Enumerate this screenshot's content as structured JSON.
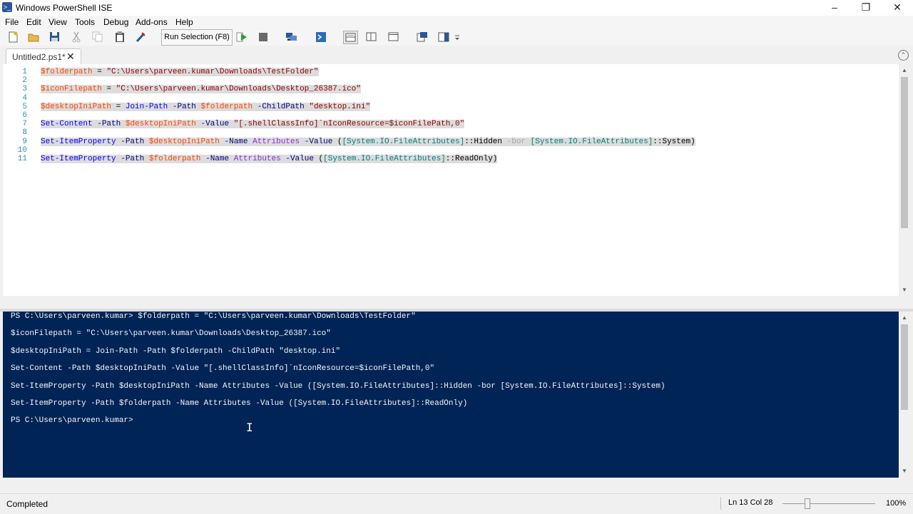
{
  "window": {
    "title": "Windows PowerShell ISE"
  },
  "menu": [
    "File",
    "Edit",
    "View",
    "Tools",
    "Debug",
    "Add-ons",
    "Help"
  ],
  "toolbar": {
    "run_selection_label": "Run Selection (F8)",
    "icons": [
      "new-file-icon",
      "open-folder-icon",
      "save-icon",
      "cut-icon",
      "copy-icon",
      "paste-icon",
      "clear-icon",
      "run-selection-button",
      "run-script-icon",
      "stop-icon",
      "remote-powershell-icon",
      "start-powershell-icon",
      "show-script-top-icon",
      "show-script-right-icon",
      "show-script-maximized-icon",
      "show-command-window-icon",
      "show-command-addon-icon",
      "customize-dropdown-icon"
    ]
  },
  "tabs": [
    {
      "label": "Untitled2.ps1*"
    }
  ],
  "editor": {
    "lines": [
      {
        "n": "1",
        "tokens": [
          [
            "var",
            "$folderpath"
          ],
          [
            "pl",
            " = "
          ],
          [
            "str",
            "\"C:\\Users\\parveen.kumar\\Downloads\\TestFolder\""
          ]
        ]
      },
      {
        "n": "2",
        "tokens": []
      },
      {
        "n": "3",
        "tokens": [
          [
            "var",
            "$iconFilepath"
          ],
          [
            "pl",
            " = "
          ],
          [
            "str",
            "\"C:\\Users\\parveen.kumar\\Downloads\\Desktop_26387.ico\""
          ]
        ]
      },
      {
        "n": "4",
        "tokens": []
      },
      {
        "n": "5",
        "tokens": [
          [
            "var",
            "$desktopIniPath"
          ],
          [
            "pl",
            " = "
          ],
          [
            "cmd",
            "Join-Path"
          ],
          [
            "pl",
            " "
          ],
          [
            "param",
            "-Path"
          ],
          [
            "pl",
            " "
          ],
          [
            "var",
            "$folderpath"
          ],
          [
            "pl",
            " "
          ],
          [
            "param",
            "-ChildPath"
          ],
          [
            "pl",
            " "
          ],
          [
            "str",
            "\"desktop.ini\""
          ]
        ]
      },
      {
        "n": "6",
        "tokens": []
      },
      {
        "n": "7",
        "tokens": [
          [
            "cmd",
            "Set-Content"
          ],
          [
            "pl",
            " "
          ],
          [
            "param",
            "-Path"
          ],
          [
            "pl",
            " "
          ],
          [
            "var",
            "$desktopIniPath"
          ],
          [
            "pl",
            " "
          ],
          [
            "param",
            "-Value"
          ],
          [
            "pl",
            " "
          ],
          [
            "str",
            "\"[.shellClassInfo]`nIconResource=$iconFilePath,0\""
          ]
        ]
      },
      {
        "n": "8",
        "tokens": []
      },
      {
        "n": "9",
        "tokens": [
          [
            "cmd",
            "Set-ItemProperty"
          ],
          [
            "pl",
            " "
          ],
          [
            "param",
            "-Path"
          ],
          [
            "pl",
            " "
          ],
          [
            "var",
            "$desktopIniPath"
          ],
          [
            "pl",
            " "
          ],
          [
            "param",
            "-Name"
          ],
          [
            "pl",
            " "
          ],
          [
            "arg",
            "Attributes"
          ],
          [
            "pl",
            " "
          ],
          [
            "param",
            "-Value"
          ],
          [
            "pl",
            " ("
          ],
          [
            "type",
            "[System.IO.FileAttributes]"
          ],
          [
            "pl",
            "::Hidden "
          ],
          [
            "op",
            "-bor"
          ],
          [
            "pl",
            " "
          ],
          [
            "type",
            "[System.IO.FileAttributes]"
          ],
          [
            "pl",
            "::System)"
          ]
        ]
      },
      {
        "n": "10",
        "tokens": []
      },
      {
        "n": "11",
        "tokens": [
          [
            "cmd",
            "Set-ItemProperty"
          ],
          [
            "pl",
            " "
          ],
          [
            "param",
            "-Path"
          ],
          [
            "pl",
            " "
          ],
          [
            "var",
            "$folderpath"
          ],
          [
            "pl",
            " "
          ],
          [
            "param",
            "-Name"
          ],
          [
            "pl",
            " "
          ],
          [
            "arg",
            "Attributes"
          ],
          [
            "pl",
            " "
          ],
          [
            "param",
            "-Value"
          ],
          [
            "pl",
            " ("
          ],
          [
            "type",
            "[System.IO.FileAttributes]"
          ],
          [
            "pl",
            "::ReadOnly)"
          ]
        ]
      }
    ]
  },
  "console": {
    "lines": [
      "PS C:\\Users\\parveen.kumar> $folderpath = \"C:\\Users\\parveen.kumar\\Downloads\\TestFolder\"",
      "$iconFilepath = \"C:\\Users\\parveen.kumar\\Downloads\\Desktop_26387.ico\"",
      "$desktopIniPath = Join-Path -Path $folderpath -ChildPath \"desktop.ini\"",
      "Set-Content -Path $desktopIniPath -Value \"[.shellClassInfo]`nIconResource=$iconFilePath,0\"",
      "Set-ItemProperty -Path $desktopIniPath -Name Attributes -Value ([System.IO.FileAttributes]::Hidden -bor [System.IO.FileAttributes]::System)",
      "Set-ItemProperty -Path $folderpath -Name Attributes -Value ([System.IO.FileAttributes]::ReadOnly)",
      "PS C:\\Users\\parveen.kumar>"
    ]
  },
  "status": {
    "text": "Completed",
    "line_col": "Ln 13  Col 28",
    "zoom": "100%",
    "zoom_level": 100
  },
  "colors": {
    "console_bg": "#012456",
    "editor_bg": "#ffffff",
    "selection": "#dcdcdc"
  }
}
